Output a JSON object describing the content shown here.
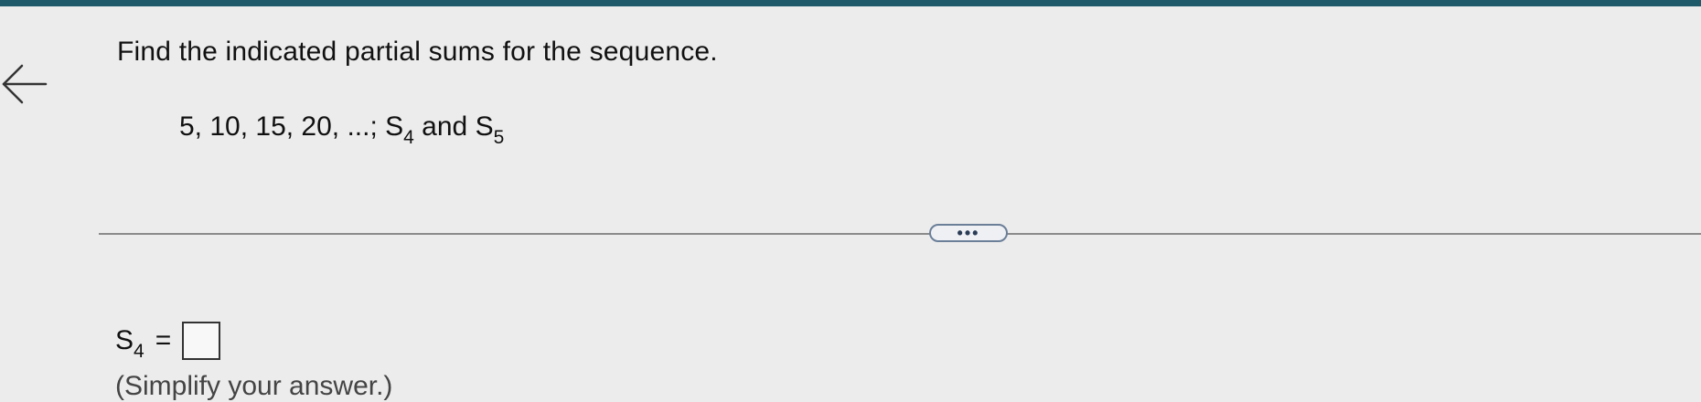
{
  "question": {
    "prompt": "Find the indicated partial sums for the sequence.",
    "sequence_terms": "5, 10, 15, 20, ...; S",
    "first_sum_sub": "4",
    "conjunction": " and S",
    "second_sum_sub": "5"
  },
  "more_button": {
    "label": "•••"
  },
  "answer": {
    "label": "S",
    "label_sub": "4",
    "equals": "=",
    "value": "",
    "hint": "(Simplify your answer.)"
  },
  "colors": {
    "top_bar": "#1f5a6b",
    "background": "#ececec",
    "more_button_border": "#6b7f98"
  }
}
